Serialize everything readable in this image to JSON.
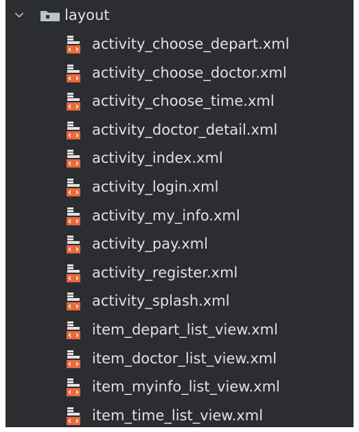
{
  "tree": {
    "folder": {
      "name": "layout",
      "expanded": true,
      "icon": "folder-icon"
    },
    "files": [
      {
        "name": "activity_choose_depart.xml",
        "icon": "xml-layout-file-icon"
      },
      {
        "name": "activity_choose_doctor.xml",
        "icon": "xml-layout-file-icon"
      },
      {
        "name": "activity_choose_time.xml",
        "icon": "xml-layout-file-icon"
      },
      {
        "name": "activity_doctor_detail.xml",
        "icon": "xml-layout-file-icon"
      },
      {
        "name": "activity_index.xml",
        "icon": "xml-layout-file-icon"
      },
      {
        "name": "activity_login.xml",
        "icon": "xml-layout-file-icon"
      },
      {
        "name": "activity_my_info.xml",
        "icon": "xml-layout-file-icon"
      },
      {
        "name": "activity_pay.xml",
        "icon": "xml-layout-file-icon"
      },
      {
        "name": "activity_register.xml",
        "icon": "xml-layout-file-icon"
      },
      {
        "name": "activity_splash.xml",
        "icon": "xml-layout-file-icon"
      },
      {
        "name": "item_depart_list_view.xml",
        "icon": "xml-layout-file-icon"
      },
      {
        "name": "item_doctor_list_view.xml",
        "icon": "xml-layout-file-icon"
      },
      {
        "name": "item_myinfo_list_view.xml",
        "icon": "xml-layout-file-icon"
      },
      {
        "name": "item_time_list_view.xml",
        "icon": "xml-layout-file-icon"
      }
    ]
  },
  "colors": {
    "background": "#2b2d30",
    "text": "#dfe1e5",
    "folder_icon": "#b9c4cf",
    "file_icon_top": "#e4e4e4",
    "file_icon_badge": "#e8693c"
  }
}
